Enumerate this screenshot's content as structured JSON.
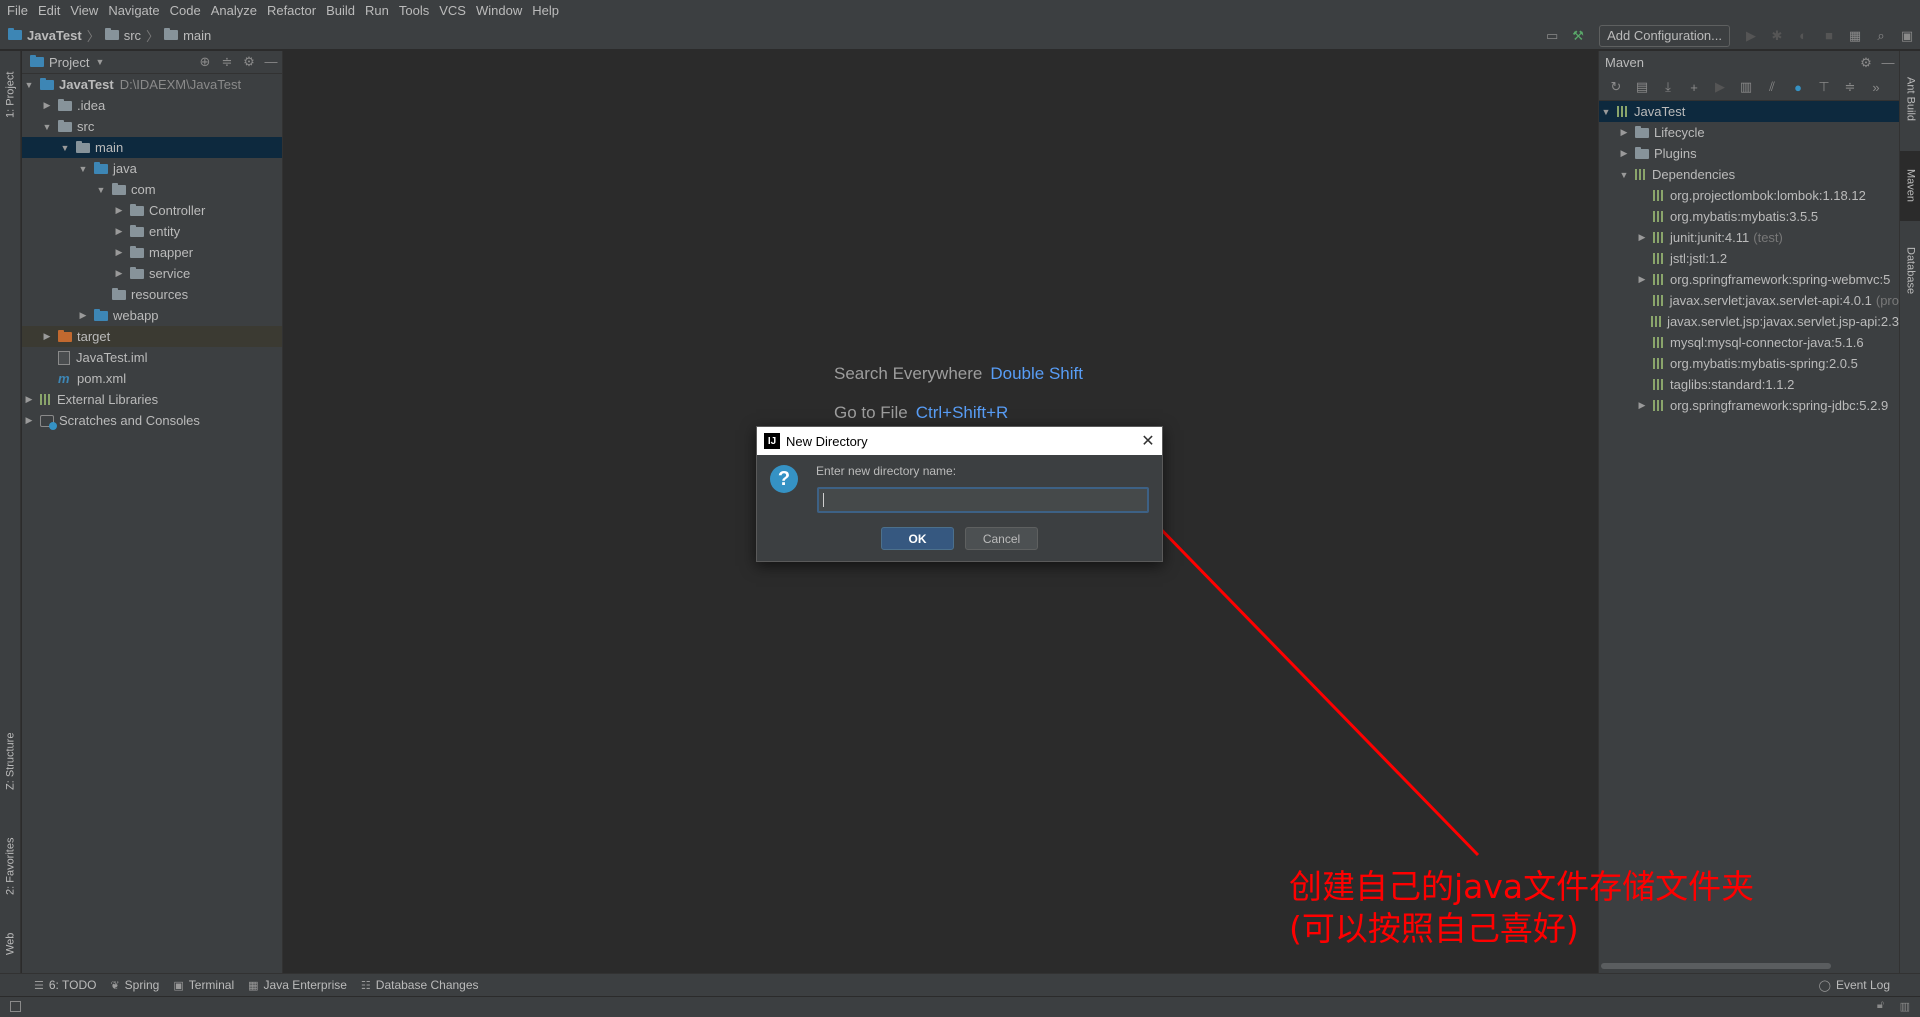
{
  "menu": [
    "File",
    "Edit",
    "View",
    "Navigate",
    "Code",
    "Analyze",
    "Refactor",
    "Build",
    "Run",
    "Tools",
    "VCS",
    "Window",
    "Help"
  ],
  "breadcrumb": {
    "project": "JavaTest",
    "part1": "src",
    "part2": "main"
  },
  "toolbar": {
    "add_config": "Add Configuration..."
  },
  "left_tabs": {
    "project": "1: Project",
    "structure": "Z: Structure",
    "favorites": "2: Favorites",
    "web": "Web"
  },
  "right_tabs": {
    "ant": "Ant Build",
    "maven": "Maven",
    "database": "Database"
  },
  "project_panel": {
    "title": "Project",
    "root_name": "JavaTest",
    "root_path": "D:\\IDAEXM\\JavaTest",
    "items": {
      "idea": ".idea",
      "src": "src",
      "main": "main",
      "java": "java",
      "com": "com",
      "controller": "Controller",
      "entity": "entity",
      "mapper": "mapper",
      "service": "service",
      "resources": "resources",
      "webapp": "webapp",
      "target": "target",
      "iml": "JavaTest.iml",
      "pom": "pom.xml",
      "ext": "External Libraries",
      "scratches": "Scratches and Consoles"
    }
  },
  "editor": {
    "hint1_label": "Search Everywhere",
    "hint1_key": "Double Shift",
    "hint2_label": "Go to File",
    "hint2_key": "Ctrl+Shift+R"
  },
  "maven": {
    "title": "Maven",
    "root": "JavaTest",
    "lifecycle": "Lifecycle",
    "plugins": "Plugins",
    "dependencies": "Dependencies",
    "deps": [
      {
        "name": "org.projectlombok:lombok:1.18.12",
        "scope": "",
        "expand": false
      },
      {
        "name": "org.mybatis:mybatis:3.5.5",
        "scope": "",
        "expand": false
      },
      {
        "name": "junit:junit:4.11",
        "scope": "(test)",
        "expand": true
      },
      {
        "name": "jstl:jstl:1.2",
        "scope": "",
        "expand": false
      },
      {
        "name": "org.springframework:spring-webmvc:5",
        "scope": "",
        "expand": true
      },
      {
        "name": "javax.servlet:javax.servlet-api:4.0.1",
        "scope": "(pro",
        "expand": false
      },
      {
        "name": "javax.servlet.jsp:javax.servlet.jsp-api:2.3",
        "scope": "",
        "expand": false
      },
      {
        "name": "mysql:mysql-connector-java:5.1.6",
        "scope": "",
        "expand": false
      },
      {
        "name": "org.mybatis:mybatis-spring:2.0.5",
        "scope": "",
        "expand": false
      },
      {
        "name": "taglibs:standard:1.1.2",
        "scope": "",
        "expand": false
      },
      {
        "name": "org.springframework:spring-jdbc:5.2.9",
        "scope": "",
        "expand": true
      }
    ]
  },
  "bottom_tabs": {
    "todo": "6: TODO",
    "spring": "Spring",
    "terminal": "Terminal",
    "javaee": "Java Enterprise",
    "dbchanges": "Database Changes",
    "eventlog": "Event Log"
  },
  "dialog": {
    "title": "New Directory",
    "label": "Enter new directory name:",
    "value": "",
    "ok": "OK",
    "cancel": "Cancel"
  },
  "annotation": {
    "line1": "创建自己的java文件存储文件夹",
    "line2": "(可以按照自己喜好)",
    "color": "#ff0000"
  }
}
